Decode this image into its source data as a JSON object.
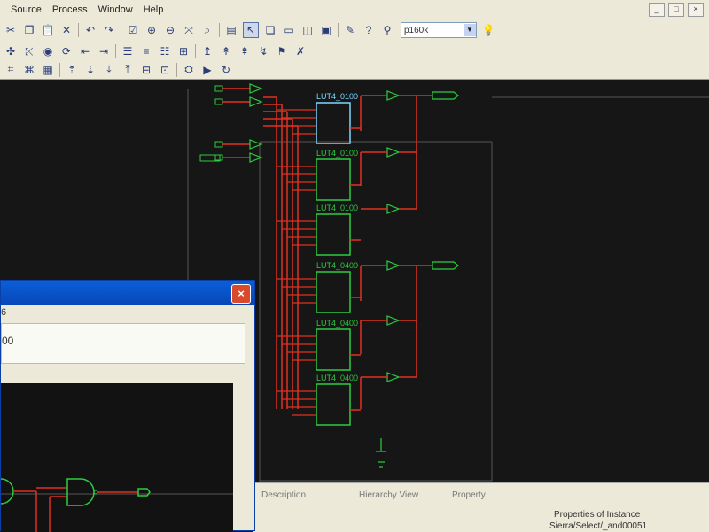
{
  "menu": [
    "Source",
    "Process",
    "Window",
    "Help"
  ],
  "window_controls": [
    "_",
    "□",
    "×"
  ],
  "toolbar1": {
    "icons": [
      "cut-icon",
      "copy-icon",
      "paste-icon",
      "delete-icon",
      "undo-icon",
      "redo-icon",
      "check-icon",
      "zoom-in-icon",
      "zoom-out-icon",
      "zoom-fit-icon",
      "zoom-select-icon",
      "doc-icon",
      "select-arrow-icon",
      "cascade-icon",
      "tile-icon",
      "panel-icon",
      "window-icon",
      "property-icon",
      "help-cursor-icon",
      "find-icon"
    ],
    "part_select_value": "p160k",
    "bulb": "bulb-icon"
  },
  "toolbar2_icons": [
    "route-icon",
    "wire-icon",
    "globe-icon",
    "rotate-icon",
    "push-icon",
    "pop-icon",
    "align-left-icon",
    "align-center-icon",
    "align-right-icon",
    "grid-icon",
    "pin-icon",
    "probe-icon",
    "bus-icon",
    "net-icon",
    "mark-icon",
    "cross-icon"
  ],
  "toolbar3_icons": [
    "sch-icon",
    "sym-icon",
    "table-icon",
    "up-icon",
    "down-icon",
    "push-in-icon",
    "pop-out-icon",
    "level-icon",
    "block-icon",
    "hier-icon",
    "run-icon",
    "stop-icon",
    "refresh-icon"
  ],
  "schematic": {
    "luts": [
      {
        "label": "LUT4_0100",
        "selected": true
      },
      {
        "label": "LUT4_0100",
        "selected": false
      },
      {
        "label": "LUT4_0100",
        "selected": false
      },
      {
        "label": "LUT4_0400",
        "selected": false
      },
      {
        "label": "LUT4_0400",
        "selected": false
      },
      {
        "label": "LUT4_0400",
        "selected": false
      }
    ]
  },
  "bottom_panel": {
    "tabs": [
      "Description",
      "Hierarchy View",
      "Property"
    ],
    "properties_title": "Properties of Instance",
    "instance_name": "Sierra/Select/_and00051"
  },
  "dialog": {
    "close_label": "×",
    "row_label": "6",
    "field_value": "00"
  }
}
